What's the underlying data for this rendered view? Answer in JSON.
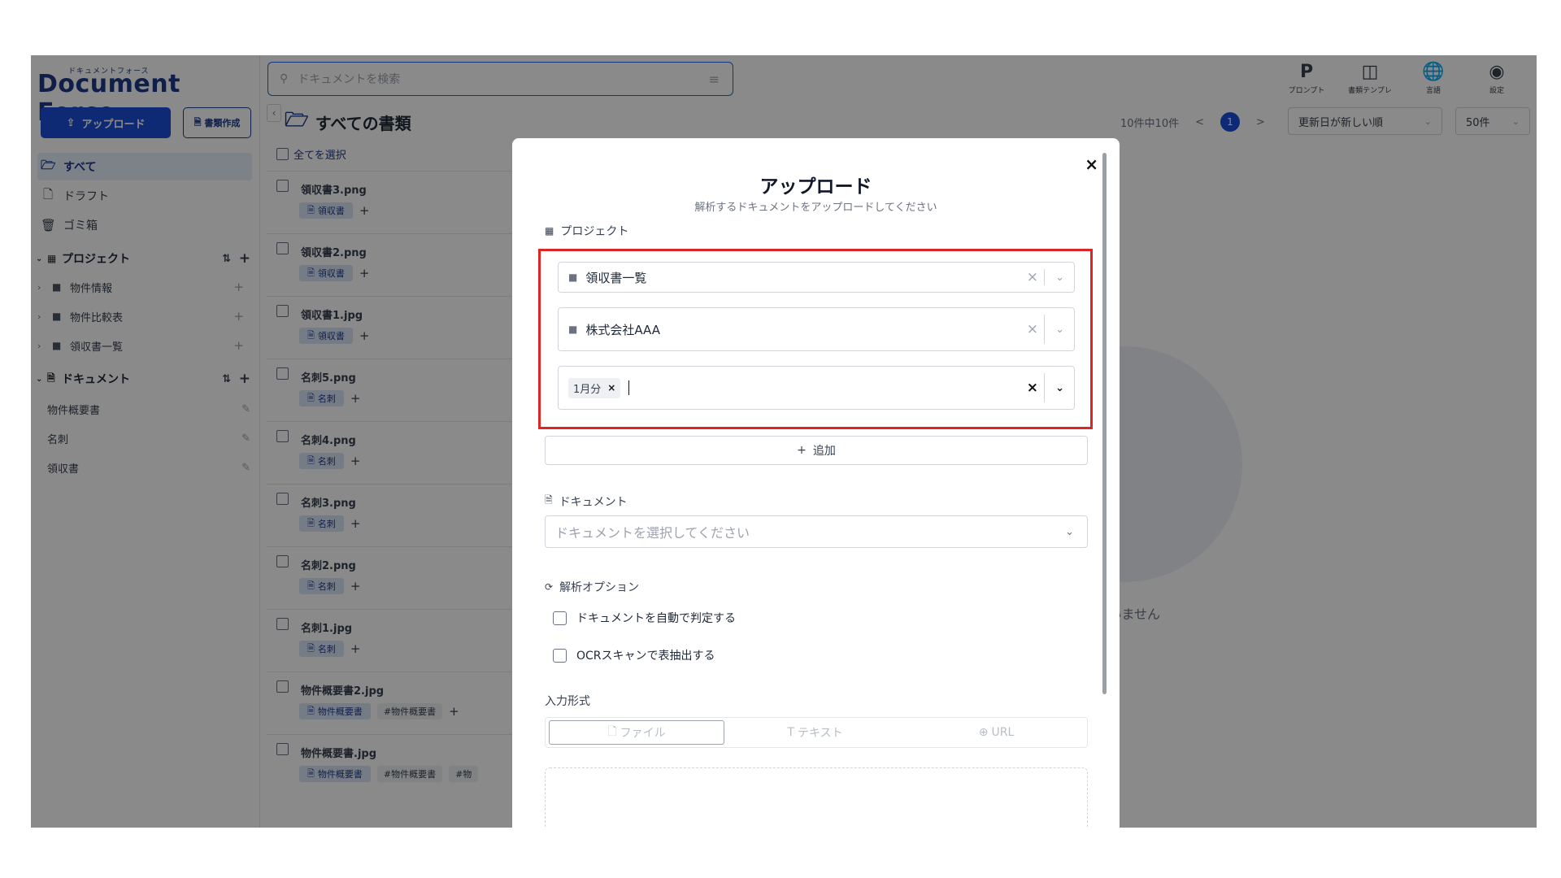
{
  "logo": {
    "small": "ドキュメントフォース",
    "main": "Document Force"
  },
  "sidebar": {
    "upload_label": "アップロード",
    "create_label": "書類作成",
    "nav": [
      {
        "label": "すべて",
        "icon": "folder-open-icon"
      },
      {
        "label": "ドラフト",
        "icon": "file-icon"
      },
      {
        "label": "ゴミ箱",
        "icon": "trash-icon"
      }
    ],
    "projects_header": "プロジェクト",
    "projects": [
      "物件情報",
      "物件比較表",
      "領収書一覧"
    ],
    "documents_header": "ドキュメント",
    "documents": [
      "物件概要書",
      "名刺",
      "領収書"
    ]
  },
  "search": {
    "placeholder": "ドキュメントを検索"
  },
  "list": {
    "title": "すべての書類",
    "select_all": "全てを選択",
    "items": [
      {
        "name": "領収書3.png",
        "tag": "領収書",
        "extra": [
          "+"
        ]
      },
      {
        "name": "領収書2.png",
        "tag": "領収書",
        "extra": [
          "+"
        ]
      },
      {
        "name": "領収書1.jpg",
        "tag": "領収書",
        "extra": [
          "+"
        ]
      },
      {
        "name": "名刺5.png",
        "tag": "名刺",
        "extra": [
          "+"
        ]
      },
      {
        "name": "名刺4.png",
        "tag": "名刺",
        "extra": [
          "+"
        ]
      },
      {
        "name": "名刺3.png",
        "tag": "名刺",
        "extra": [
          "+"
        ]
      },
      {
        "name": "名刺2.png",
        "tag": "名刺",
        "extra": [
          "+"
        ]
      },
      {
        "name": "名刺1.jpg",
        "tag": "名刺",
        "extra": [
          "+"
        ]
      },
      {
        "name": "物件概要書2.jpg",
        "tag": "物件概要書",
        "hashtag": "#物件概要書",
        "extra": [
          "+"
        ]
      },
      {
        "name": "物件概要書.jpg",
        "tag": "物件概要書",
        "hashtag": "#物件概要書",
        "hashtag2": "#物"
      }
    ]
  },
  "topbar": {
    "icons": [
      {
        "label": "プロンプト",
        "glyph": "P",
        "icon": "prompt-icon"
      },
      {
        "label": "書類テンプレ",
        "glyph": "◫",
        "icon": "template-icon"
      },
      {
        "label": "言語",
        "glyph": "🌐",
        "icon": "globe-icon"
      },
      {
        "label": "設定",
        "glyph": "◉",
        "icon": "user-settings-icon"
      }
    ],
    "count_text": "10件中10件",
    "page": "1",
    "prev": "<",
    "next": ">",
    "sort": "更新日が新しい順",
    "per_page": "50件"
  },
  "empty_state": {
    "text": "選択されていません"
  },
  "modal": {
    "title": "アップロード",
    "subtitle": "解析するドキュメントをアップロードしてください",
    "close": "×",
    "project_label": "プロジェクト",
    "project_selects": [
      {
        "value": "領収書一覧"
      },
      {
        "value": "株式会社AAA"
      },
      {
        "chip": "1月分"
      }
    ],
    "add_label": "追加",
    "document_label": "ドキュメント",
    "document_placeholder": "ドキュメントを選択してください",
    "options_label": "解析オプション",
    "options": [
      {
        "label": "ドキュメントを自動で判定する",
        "checked": false
      },
      {
        "label": "OCRスキャンで表抽出する",
        "checked": false
      }
    ],
    "input_format_label": "入力形式",
    "tabs": [
      {
        "label": "ファイル",
        "icon": "file-icon"
      },
      {
        "label": "テキスト",
        "icon": "text-icon"
      },
      {
        "label": "URL",
        "icon": "link-icon"
      }
    ]
  },
  "colors": {
    "brand": "#1e3a8a",
    "primary": "#1d4ed8",
    "highlight": "#dc2626"
  }
}
